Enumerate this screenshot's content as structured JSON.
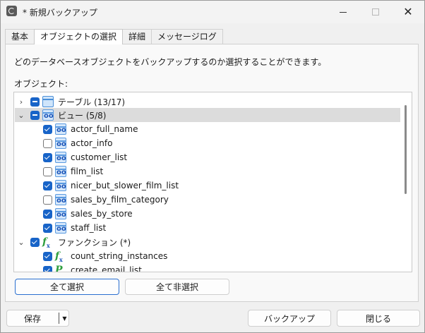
{
  "window": {
    "title": "* 新規バックアップ",
    "icon": "backup-restore-icon"
  },
  "tabs": [
    {
      "label": "基本",
      "active": false
    },
    {
      "label": "オブジェクトの選択",
      "active": true
    },
    {
      "label": "詳細",
      "active": false
    },
    {
      "label": "メッセージログ",
      "active": false
    }
  ],
  "description": "どのデータベースオブジェクトをバックアップするのか選択することができます。",
  "objects_label": "オブジェクト:",
  "tree": [
    {
      "label": "テーブル (13/17)",
      "level": 0,
      "expander": "collapsed",
      "check": "partial",
      "icon": "table-icon",
      "selected": false
    },
    {
      "label": "ビュー (5/8)",
      "level": 0,
      "expander": "expanded",
      "check": "partial",
      "icon": "view-icon",
      "selected": true
    },
    {
      "label": "actor_full_name",
      "level": 1,
      "check": "checked",
      "icon": "view-icon"
    },
    {
      "label": "actor_info",
      "level": 1,
      "check": "unchecked",
      "icon": "view-icon"
    },
    {
      "label": "customer_list",
      "level": 1,
      "check": "checked",
      "icon": "view-icon"
    },
    {
      "label": "film_list",
      "level": 1,
      "check": "unchecked",
      "icon": "view-icon"
    },
    {
      "label": "nicer_but_slower_film_list",
      "level": 1,
      "check": "checked",
      "icon": "view-icon"
    },
    {
      "label": "sales_by_film_category",
      "level": 1,
      "check": "unchecked",
      "icon": "view-icon"
    },
    {
      "label": "sales_by_store",
      "level": 1,
      "check": "checked",
      "icon": "view-icon"
    },
    {
      "label": "staff_list",
      "level": 1,
      "check": "checked",
      "icon": "view-icon"
    },
    {
      "label": "ファンクション (*)",
      "level": 0,
      "expander": "expanded",
      "check": "checked",
      "icon": "function-icon"
    },
    {
      "label": "count_string_instances",
      "level": 1,
      "check": "checked",
      "icon": "function-icon"
    },
    {
      "label": "create_email_list",
      "level": 1,
      "check": "checked",
      "icon": "procedure-icon"
    }
  ],
  "buttons": {
    "select_all": "全て選択",
    "deselect_all": "全て非選択",
    "save": "保存",
    "backup": "バックアップ",
    "close": "閉じる"
  },
  "colors": {
    "accent": "#1864c8",
    "selected_row": "#dcdcdc"
  }
}
